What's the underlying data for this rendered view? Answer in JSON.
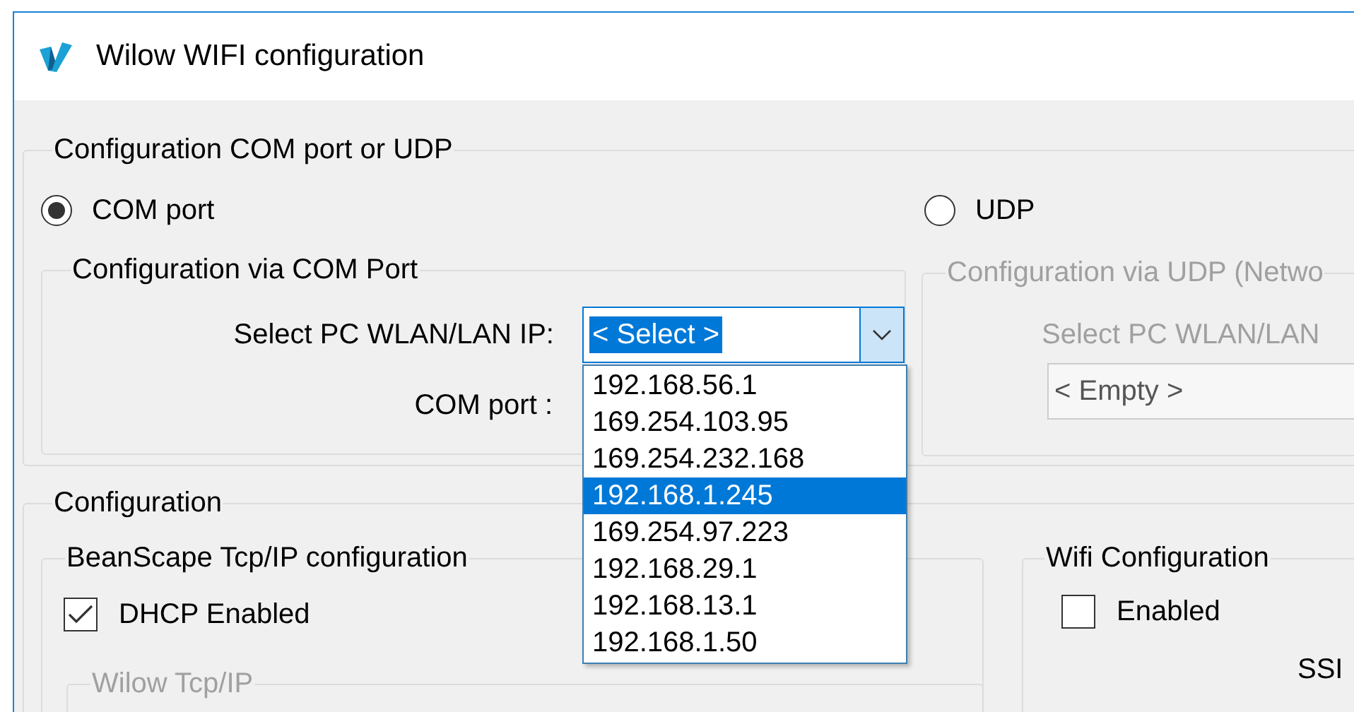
{
  "window": {
    "title": "Wilow WIFI configuration"
  },
  "mode_group": {
    "title": "Configuration COM port or UDP",
    "options": [
      {
        "label": "COM port",
        "selected": true
      },
      {
        "label": "UDP",
        "selected": false
      }
    ]
  },
  "com_group": {
    "title": "Configuration via COM Port",
    "ip_label": "Select PC WLAN/LAN IP:",
    "ip_value": "< Select >",
    "com_label": "COM port :",
    "dropdown": {
      "expanded": true,
      "items": [
        {
          "label": "192.168.56.1",
          "selected": false
        },
        {
          "label": "169.254.103.95",
          "selected": false
        },
        {
          "label": "169.254.232.168",
          "selected": false
        },
        {
          "label": "192.168.1.245",
          "selected": true
        },
        {
          "label": "169.254.97.223",
          "selected": false
        },
        {
          "label": "192.168.29.1",
          "selected": false
        },
        {
          "label": "192.168.13.1",
          "selected": false
        },
        {
          "label": "192.168.1.50",
          "selected": false
        }
      ]
    }
  },
  "udp_group": {
    "title": "Configuration via UDP (Netwo",
    "disabled": true,
    "ip_label": "Select PC WLAN/LAN",
    "ip_value": "< Empty >"
  },
  "config_group": {
    "title": "Configuration",
    "beanscape": {
      "title": "BeanScape Tcp/IP configuration",
      "dhcp": {
        "label": "DHCP Enabled",
        "checked": true
      },
      "wilow_group": {
        "title": "Wilow Tcp/IP",
        "disabled": true
      }
    },
    "wifi": {
      "title": "Wifi Configuration",
      "enabled": {
        "label": "Enabled",
        "checked": false
      },
      "ssid_label": "SSI"
    }
  }
}
